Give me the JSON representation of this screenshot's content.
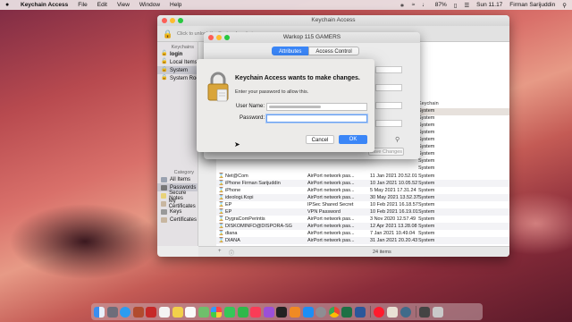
{
  "menubar": {
    "app_name": "Keychain Access",
    "menus": [
      "File",
      "Edit",
      "View",
      "Window",
      "Help"
    ],
    "battery": "87%",
    "clock": "Sun 11.17",
    "user": "Firman Sarijuddin"
  },
  "keychain_window": {
    "title": "Keychain Access",
    "lock_hint": "Click to unlock the System keychain.",
    "keychains_header": "Keychains",
    "keychains": [
      "login",
      "Local Items",
      "System",
      "System Roots"
    ],
    "category_header": "Category",
    "categories": [
      "All Items",
      "Passwords",
      "Secure Notes",
      "My Certificates",
      "Keys",
      "Certificates"
    ],
    "column_keychain": "Keychain",
    "upper_rows_keychain": [
      "System",
      "System",
      "System",
      "System",
      "System",
      "System",
      "System",
      "System",
      "System"
    ],
    "rows": [
      {
        "name": "Net@Com",
        "kind": "AirPort network pas...",
        "date": "11 Jan 2021 20.52.01",
        "keychain": "System"
      },
      {
        "name": "iPhone Firman Sarijuddin",
        "kind": "AirPort network pas...",
        "date": "10 Jan 2021 10.05.52",
        "keychain": "System"
      },
      {
        "name": "iPhone",
        "kind": "AirPort network pas...",
        "date": "5 May 2021 17.31.24",
        "keychain": "System"
      },
      {
        "name": "ideologi.Kopi",
        "kind": "AirPort network pas...",
        "date": "30 May 2021 13.52.37",
        "keychain": "System"
      },
      {
        "name": "EP",
        "kind": "IPSec Shared Secret",
        "date": "10 Feb 2021 16.18.57",
        "keychain": "System"
      },
      {
        "name": "EP",
        "kind": "VPN Password",
        "date": "10 Feb 2021 16.19.01",
        "keychain": "System"
      },
      {
        "name": "DygraComPerintis",
        "kind": "AirPort network pas...",
        "date": "3 Nov 2020 12.57.49",
        "keychain": "System"
      },
      {
        "name": "DISKOMINFO@DISPORA-SG",
        "kind": "AirPort network pas...",
        "date": "12 Apr 2021 13.28.08",
        "keychain": "System"
      },
      {
        "name": "diana",
        "kind": "AirPort network pas...",
        "date": "7 Jan 2021 10.49.04",
        "keychain": "System"
      },
      {
        "name": "DIANA",
        "kind": "AirPort network pas...",
        "date": "31 Jan 2021 20.20.43",
        "keychain": "System"
      }
    ],
    "item_count": "24 items"
  },
  "item_window": {
    "title": "Warkop 115 GAMERS",
    "tab_attributes": "Attributes",
    "tab_access": "Access Control",
    "save_label": "Save Changes"
  },
  "auth_dialog": {
    "title": "Keychain Access wants to make changes.",
    "subtitle": "Enter your password to allow this.",
    "username_label": "User Name:",
    "password_label": "Password:",
    "cancel_label": "Cancel",
    "ok_label": "OK"
  },
  "colors": {
    "accent": "#3b86f7"
  },
  "dock_icons": [
    "finder-icon",
    "launchpad-icon",
    "safari-icon",
    "mail-icon",
    "photo-booth-icon",
    "calendar-icon",
    "notes-icon",
    "reminders-icon",
    "maps-icon",
    "photos-icon",
    "messages-icon",
    "facetime-icon",
    "music-icon",
    "podcasts-icon",
    "tv-icon",
    "books-icon",
    "app-store-icon",
    "system-preferences-icon",
    "chrome-icon",
    "excel-icon",
    "word-icon",
    "opera-icon",
    "preview-icon",
    "quicktime-icon",
    "downloads-icon",
    "trash-icon"
  ]
}
